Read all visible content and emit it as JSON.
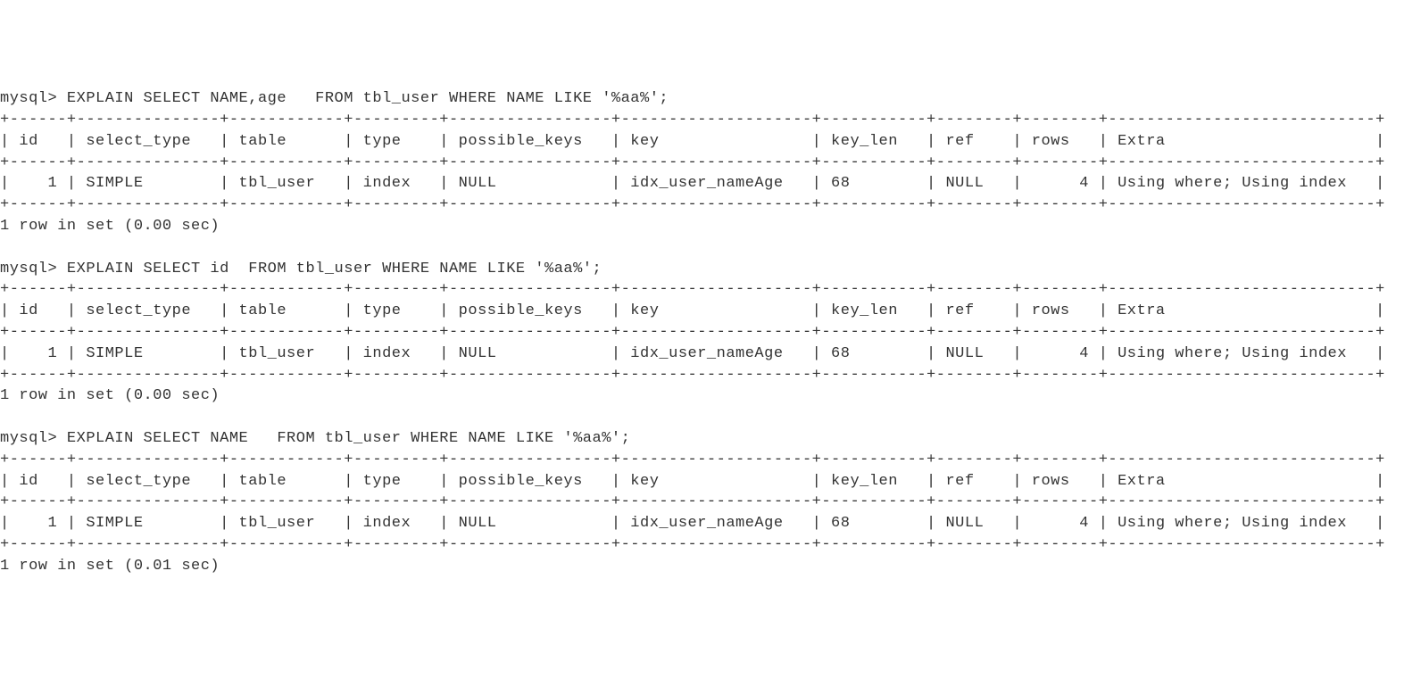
{
  "prompt": "mysql> ",
  "queries": [
    {
      "sql": "EXPLAIN SELECT NAME,age   FROM tbl_user WHERE NAME LIKE '%aa%';",
      "summary": "1 row in set (0.00 sec)",
      "table": {
        "headers": [
          "id",
          "select_type",
          "table",
          "type",
          "possible_keys",
          "key",
          "key_len",
          "ref",
          "rows",
          "Extra"
        ],
        "widths": [
          4,
          13,
          10,
          7,
          15,
          18,
          9,
          6,
          6,
          26
        ],
        "rows": [
          [
            "1",
            "SIMPLE",
            "tbl_user",
            "index",
            "NULL",
            "idx_user_nameAge",
            "68",
            "NULL",
            "4",
            "Using where; Using index"
          ]
        ],
        "rightAlign": [
          0,
          8
        ]
      }
    },
    {
      "sql": "EXPLAIN SELECT id  FROM tbl_user WHERE NAME LIKE '%aa%';",
      "summary": "1 row in set (0.00 sec)",
      "table": {
        "headers": [
          "id",
          "select_type",
          "table",
          "type",
          "possible_keys",
          "key",
          "key_len",
          "ref",
          "rows",
          "Extra"
        ],
        "widths": [
          4,
          13,
          10,
          7,
          15,
          18,
          9,
          6,
          6,
          26
        ],
        "rows": [
          [
            "1",
            "SIMPLE",
            "tbl_user",
            "index",
            "NULL",
            "idx_user_nameAge",
            "68",
            "NULL",
            "4",
            "Using where; Using index"
          ]
        ],
        "rightAlign": [
          0,
          8
        ]
      }
    },
    {
      "sql": "EXPLAIN SELECT NAME   FROM tbl_user WHERE NAME LIKE '%aa%';",
      "summary": "1 row in set (0.01 sec)",
      "table": {
        "headers": [
          "id",
          "select_type",
          "table",
          "type",
          "possible_keys",
          "key",
          "key_len",
          "ref",
          "rows",
          "Extra"
        ],
        "widths": [
          4,
          13,
          10,
          7,
          15,
          18,
          9,
          6,
          6,
          26
        ],
        "rows": [
          [
            "1",
            "SIMPLE",
            "tbl_user",
            "index",
            "NULL",
            "idx_user_nameAge",
            "68",
            "NULL",
            "4",
            "Using where; Using index"
          ]
        ],
        "rightAlign": [
          0,
          8
        ]
      }
    }
  ]
}
